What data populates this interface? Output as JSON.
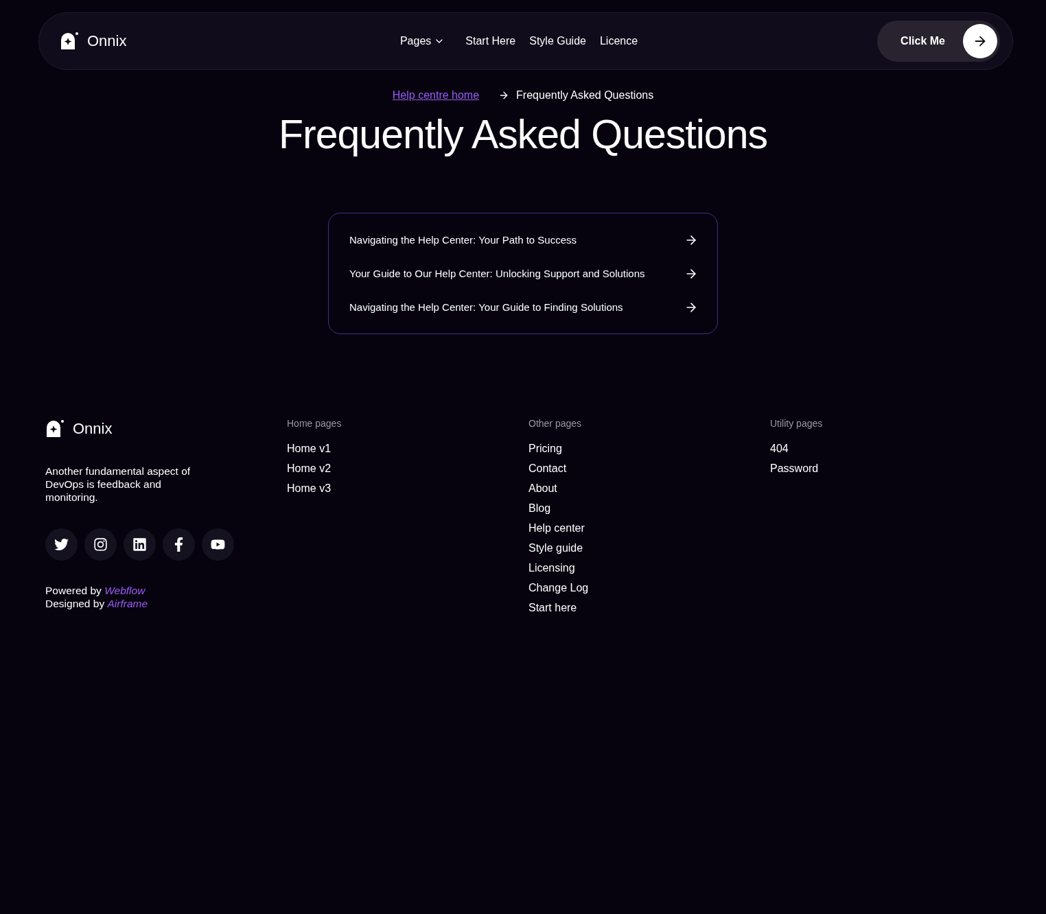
{
  "nav": {
    "brand": "Onnix",
    "links": [
      {
        "label": "Pages",
        "dropdown": true
      },
      {
        "label": "Start Here",
        "dropdown": false
      },
      {
        "label": "Style Guide",
        "dropdown": false
      },
      {
        "label": "Licence",
        "dropdown": false
      }
    ],
    "cta": "Click Me"
  },
  "breadcrumb": {
    "link": "Help centre home",
    "current": "Frequently Asked Questions"
  },
  "title": "Frequently Asked Questions",
  "articles": [
    "Navigating the Help Center: Your Path to Success",
    "Your Guide to Our Help Center: Unlocking Support and Solutions",
    "Navigating the Help Center: Your Guide to Finding Solutions"
  ],
  "footer": {
    "brand": "Onnix",
    "tagline": "Another fundamental aspect of DevOps is feedback and monitoring.",
    "credits": [
      {
        "text": "Powered by",
        "link": "Webflow"
      },
      {
        "text": "Designed by",
        "link": "Airframe"
      }
    ],
    "columns": [
      {
        "heading": "Home pages",
        "links": [
          "Home v1",
          "Home v2",
          "Home v3"
        ]
      },
      {
        "heading": "Other pages",
        "links": [
          "Pricing",
          "Contact",
          "About",
          "Blog",
          "Help center",
          "Style guide",
          "Licensing",
          "Change Log",
          "Start here"
        ]
      },
      {
        "heading": "Utility pages",
        "links": [
          "404",
          "Password"
        ]
      }
    ]
  }
}
